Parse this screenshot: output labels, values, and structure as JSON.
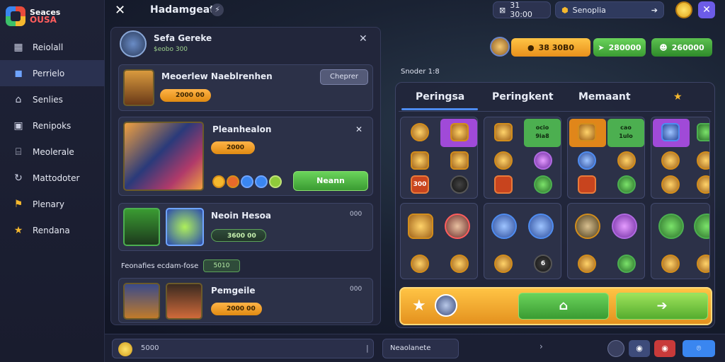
{
  "app": {
    "logo_line1": "Seaces",
    "logo_line2": "OUSA"
  },
  "sidebar": {
    "items": [
      {
        "label": "Reiolall",
        "icon": "grid-icon"
      },
      {
        "label": "Perrielo",
        "icon": "cube-icon"
      },
      {
        "label": "Senlies",
        "icon": "house-icon"
      },
      {
        "label": "Renipoks",
        "icon": "monitor-icon"
      },
      {
        "label": "Meolerale",
        "icon": "shop-icon"
      },
      {
        "label": "Mattodoter",
        "icon": "refresh-icon"
      },
      {
        "label": "Plenary",
        "icon": "flag-icon"
      },
      {
        "label": "Rendana",
        "icon": "star-icon"
      }
    ]
  },
  "topbar": {
    "title": "Hadamgeat",
    "counter": "31 30:00",
    "region": "Senoplia"
  },
  "panel": {
    "player_name": "Sefa Gereke",
    "player_sub": "$eobo 300",
    "cards": [
      {
        "title": "Meoerlew Naeblrenhen",
        "pill": "2000 00",
        "button": "Cheprer"
      },
      {
        "title": "Pleanhealon",
        "pill": "2000",
        "button": "Neann"
      },
      {
        "title": "Neoin Hesoa",
        "pill": "3600 00",
        "side": "000"
      },
      {
        "title": "Pemgeile",
        "pill": "2000 00",
        "side": "000"
      }
    ],
    "mid_label": "Feonafies ecdam-fose",
    "mid_chip": "5010"
  },
  "resources": {
    "gold": "38 30B0",
    "gems": "280000",
    "energy": "260000"
  },
  "board": {
    "section_label": "Snoder 1:8",
    "tabs": [
      "Peringsa",
      "Peringkent",
      "Memaant"
    ],
    "tiles": [
      {
        "t1": "ocio",
        "t2": "9ia8"
      },
      {
        "t1": "cao",
        "t2": "1ulo"
      }
    ],
    "labels": [
      "300",
      "6"
    ]
  },
  "bottom": {
    "search_value": "5000",
    "select_value": "Neaolanete"
  }
}
